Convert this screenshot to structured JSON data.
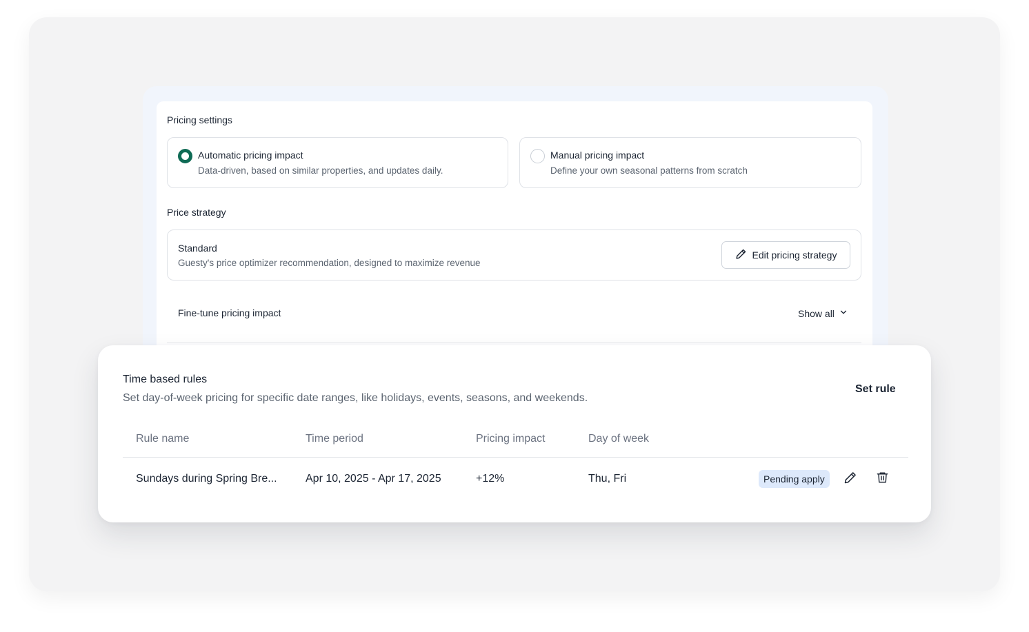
{
  "pricing_settings": {
    "title": "Pricing settings",
    "options": [
      {
        "title": "Automatic pricing impact",
        "description": "Data-driven, based on similar properties, and updates daily.",
        "selected": true
      },
      {
        "title": "Manual pricing impact",
        "description": "Define your own seasonal patterns from scratch",
        "selected": false
      }
    ]
  },
  "price_strategy": {
    "title": "Price strategy",
    "name": "Standard",
    "description": "Guesty's price optimizer recommendation, designed to maximize revenue",
    "edit_button": "Edit pricing strategy"
  },
  "fine_tune": {
    "label": "Fine-tune pricing impact",
    "show_all": "Show all"
  },
  "time_based_rules": {
    "title": "Time based rules",
    "description": "Set day-of-week pricing for specific date ranges, like holidays, events, seasons, and weekends.",
    "set_rule": "Set rule",
    "columns": [
      "Rule name",
      "Time period",
      "Pricing impact",
      "Day of week"
    ],
    "rows": [
      {
        "rule_name": "Sundays during Spring Bre...",
        "time_period": "Apr 10, 2025 - Apr 17, 2025",
        "pricing_impact": "+12%",
        "day_of_week": "Thu, Fri",
        "status": "Pending apply"
      }
    ]
  },
  "colors": {
    "accent": "#0f6b55",
    "badge_bg": "#dde9fb",
    "stage_bg": "#f3f3f4"
  },
  "icons": [
    "pencil-icon",
    "chevron-down-icon",
    "trash-icon",
    "radio-icon"
  ]
}
